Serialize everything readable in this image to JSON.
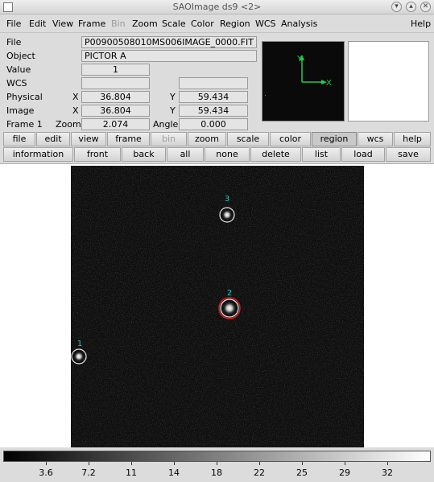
{
  "window": {
    "title": "SAOImage ds9 <2>"
  },
  "menubar": [
    {
      "label": "File",
      "disabled": false
    },
    {
      "label": "Edit",
      "disabled": false
    },
    {
      "label": "View",
      "disabled": false
    },
    {
      "label": "Frame",
      "disabled": false
    },
    {
      "label": "Bin",
      "disabled": true
    },
    {
      "label": "Zoom",
      "disabled": false
    },
    {
      "label": "Scale",
      "disabled": false
    },
    {
      "label": "Color",
      "disabled": false
    },
    {
      "label": "Region",
      "disabled": false
    },
    {
      "label": "WCS",
      "disabled": false
    },
    {
      "label": "Analysis",
      "disabled": false
    }
  ],
  "help_menu": "Help",
  "info": {
    "file_label": "File",
    "file_value": "P00900508010MS006IMAGE_0000.FIT",
    "object_label": "Object",
    "object_value": "PICTOR A",
    "value_label": "Value",
    "value_value": "1",
    "wcs_label": "WCS",
    "wcs_value": "",
    "wcs_value2": "",
    "physical_label": "Physical",
    "physical_x_label": "X",
    "physical_x": "36.804",
    "physical_y_label": "Y",
    "physical_y": "59.434",
    "image_label": "Image",
    "image_x_label": "X",
    "image_x": "36.804",
    "image_y_label": "Y",
    "image_y": "59.434",
    "frame_label": "Frame 1",
    "zoom_label": "Zoom",
    "zoom_value": "2.074",
    "angle_label": "Angle",
    "angle_value": "0.000"
  },
  "magnifier": {
    "y_label": "Y",
    "x_label": "X",
    "arrow_color": "#22cc44"
  },
  "buttons_row1": [
    {
      "label": "file",
      "state": "normal"
    },
    {
      "label": "edit",
      "state": "normal"
    },
    {
      "label": "view",
      "state": "normal"
    },
    {
      "label": "frame",
      "state": "normal"
    },
    {
      "label": "bin",
      "state": "disabled"
    },
    {
      "label": "zoom",
      "state": "normal"
    },
    {
      "label": "scale",
      "state": "normal"
    },
    {
      "label": "color",
      "state": "normal"
    },
    {
      "label": "region",
      "state": "active"
    },
    {
      "label": "wcs",
      "state": "normal"
    },
    {
      "label": "help",
      "state": "normal"
    }
  ],
  "buttons_row2": [
    {
      "label": "information"
    },
    {
      "label": "front"
    },
    {
      "label": "back"
    },
    {
      "label": "all"
    },
    {
      "label": "none"
    },
    {
      "label": "delete"
    },
    {
      "label": "list"
    },
    {
      "label": "load"
    },
    {
      "label": "save"
    }
  ],
  "regions": [
    {
      "label": "1",
      "selected": false
    },
    {
      "label": "2",
      "selected": true
    },
    {
      "label": "3",
      "selected": false
    }
  ],
  "colors": {
    "region_label": "#28c8c8",
    "region_selected": "#d42020",
    "region_circle": "#e8e8e8"
  },
  "colorbar": {
    "ticks": [
      "3.6",
      "7.2",
      "11",
      "14",
      "18",
      "22",
      "25",
      "29",
      "32"
    ]
  }
}
